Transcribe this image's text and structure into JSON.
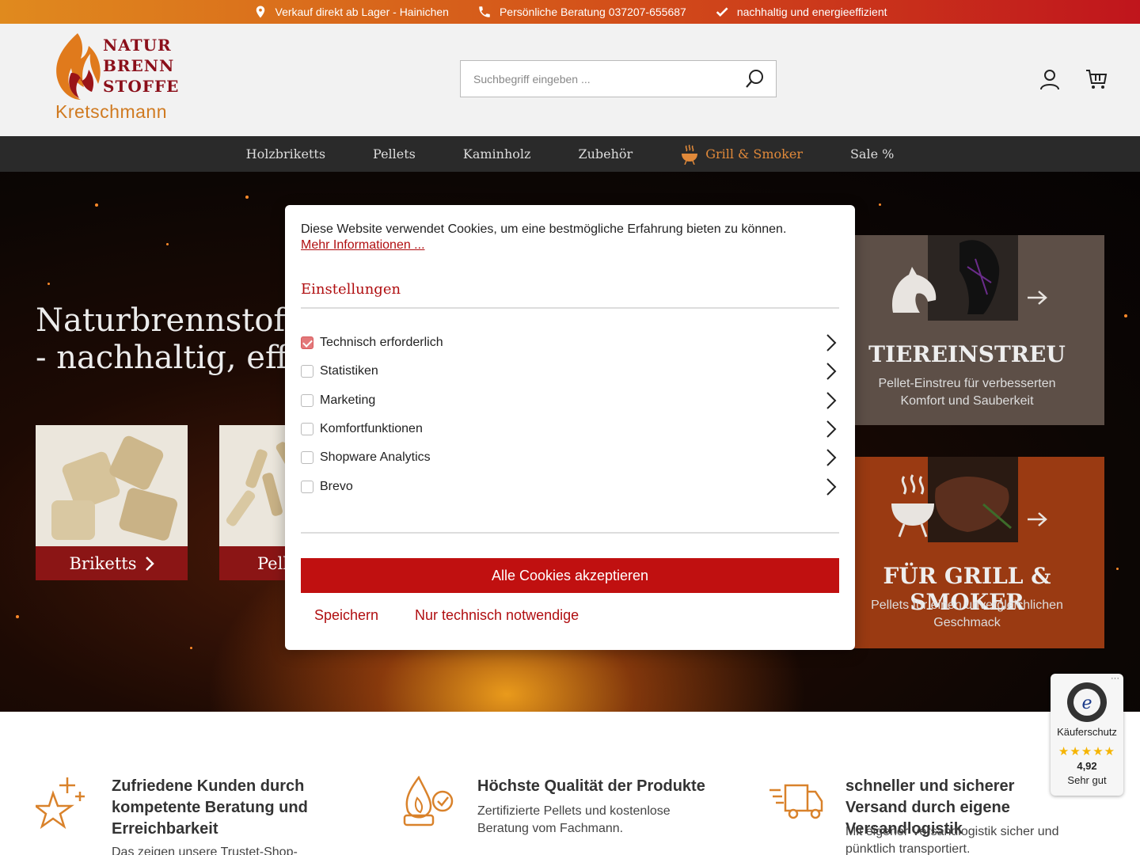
{
  "topbar": {
    "items": [
      {
        "icon": "location-pin-icon",
        "label": "Verkauf direkt ab Lager - Hainichen"
      },
      {
        "icon": "phone-icon",
        "label": "Persönliche Beratung 037207-655687"
      },
      {
        "icon": "checkmark-icon",
        "label": "nachhaltig und energieeffizient"
      }
    ]
  },
  "logo": {
    "line1": "NATUR",
    "line2": "BRENN",
    "line3": "STOFFE",
    "line4": "Kretschmann"
  },
  "search": {
    "placeholder": "Suchbegriff eingeben ..."
  },
  "nav": {
    "items": [
      "Holzbriketts",
      "Pellets",
      "Kaminholz",
      "Zubehör",
      "Grill & Smoker",
      "Sale %"
    ],
    "active": "Grill & Smoker"
  },
  "hero": {
    "line1": "Naturbrennstoffe",
    "line2": "- nachhaltig, effiz",
    "tiles": [
      {
        "label": "Briketts"
      },
      {
        "label": "Pell"
      }
    ]
  },
  "promos": [
    {
      "title": "TIEREINSTREU",
      "text": "Pellet-Einstreu für verbesserten Komfort und Sauberkeit",
      "icon": "horse-head-icon"
    },
    {
      "title": "FÜR GRILL & SMOKER",
      "text": "Pellets für einen unvergleichlichen Geschmack",
      "icon": "grill-icon"
    }
  ],
  "features": [
    {
      "icon": "star-plus-icon",
      "title": "Zufriedene Kunden durch kompetente Beratung und Erreichbarkeit",
      "text": "Das zeigen unsere Trustet-Shop-"
    },
    {
      "icon": "flame-quality-icon",
      "title": "Höchste Qualität der Produkte",
      "text": "Zertifizierte Pellets und kostenlose Beratung vom Fachmann."
    },
    {
      "icon": "delivery-truck-icon",
      "title": "schneller und sicherer Versand durch eigene Versandlogistik",
      "text": "Mit eigener Versandlogistik sicher und pünktlich transportiert."
    }
  ],
  "trust": {
    "label": "Käuferschutz",
    "stars": "★★★★★",
    "score": "4,92",
    "rating": "Sehr gut",
    "more": "···"
  },
  "cookie": {
    "intro": "Diese Website verwendet Cookies, um eine bestmögliche Erfahrung bieten zu können.",
    "more_link": "Mehr Informationen ...",
    "settings_title": "Einstellungen",
    "options": [
      {
        "label": "Technisch erforderlich",
        "checked": true
      },
      {
        "label": "Statistiken",
        "checked": false
      },
      {
        "label": "Marketing",
        "checked": false
      },
      {
        "label": "Komfortfunktionen",
        "checked": false
      },
      {
        "label": "Shopware Analytics",
        "checked": false
      },
      {
        "label": "Brevo",
        "checked": false
      }
    ],
    "accept_all": "Alle Cookies akzeptieren",
    "save": "Speichern",
    "only_technical": "Nur technisch notwendige"
  },
  "colors": {
    "brand_red": "#c01010",
    "accent_orange": "#e0893a",
    "nav_bg": "#2a2a2a"
  }
}
